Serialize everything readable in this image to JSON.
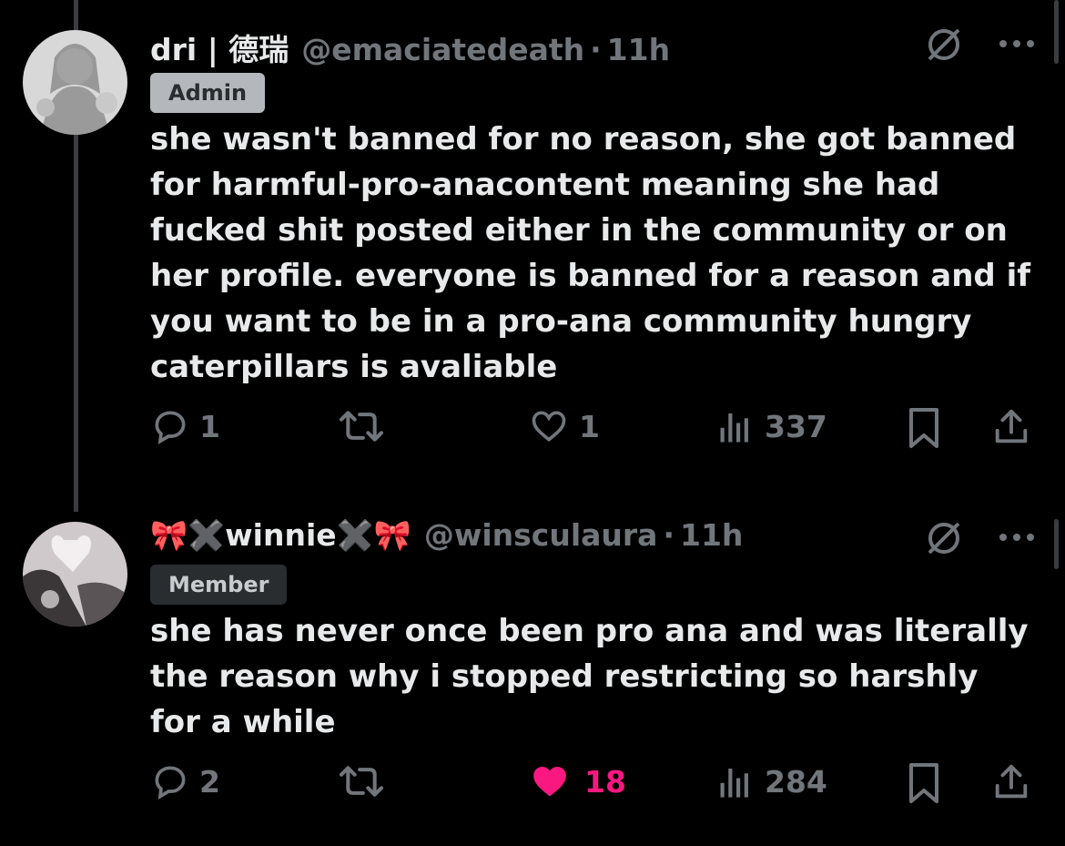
{
  "posts": [
    {
      "display_name": "dri | 德瑞",
      "handle": "@emaciatedeath",
      "separator": "·",
      "time": "11h",
      "badge": "Admin",
      "text_lines": [
        "she wasn't banned for no reason, she got banned",
        "for harmful-pro-anacontent meaning she had",
        "fucked shit posted either in the community or on",
        "her profile. everyone is banned for a reason and if",
        "you want to be in a pro-ana community hungry",
        "caterpillars is avaliable"
      ],
      "stats": {
        "replies": "1",
        "reposts": "",
        "likes": "1",
        "views": "337"
      },
      "liked": false
    },
    {
      "display_name": "🎀✖️winnie✖️🎀",
      "handle": "@winsculaura",
      "separator": "·",
      "time": "11h",
      "badge": "Member",
      "text_lines": [
        "she has never once been pro ana and was literally",
        "the reason why i stopped restricting so harshly",
        "for a while"
      ],
      "stats": {
        "replies": "2",
        "reposts": "",
        "likes": "18",
        "views": "284"
      },
      "liked": true
    }
  ],
  "colors": {
    "background": "#000000",
    "text": "#e7e9ea",
    "muted": "#71767b",
    "like_active": "#f91880"
  },
  "icons": [
    "reply-icon",
    "repost-icon",
    "like-icon",
    "views-icon",
    "bookmark-icon",
    "share-icon",
    "hidden-reply-icon",
    "more-icon"
  ]
}
